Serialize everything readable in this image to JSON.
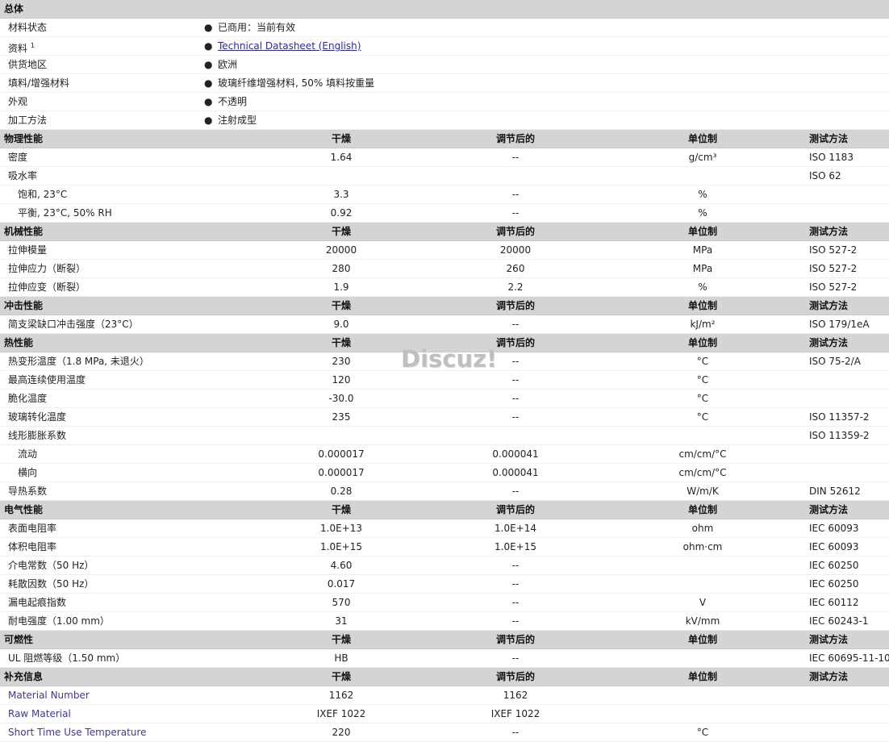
{
  "general": {
    "title": "总体",
    "rows": [
      {
        "label": "材料状态",
        "value": "已商用：当前有效"
      },
      {
        "label": "资料",
        "sup": "1",
        "value": "Technical Datasheet (English)",
        "link": true
      },
      {
        "label": "供货地区",
        "value": "欧洲"
      },
      {
        "label": "填料/增强材料",
        "value": "玻璃纤维增强材料, 50% 填料按重量"
      },
      {
        "label": "外观",
        "value": "不透明"
      },
      {
        "label": "加工方法",
        "value": "注射成型"
      }
    ]
  },
  "columns": {
    "dry": "干燥",
    "cond": "调节后的",
    "unit": "单位制",
    "method": "测试方法"
  },
  "sections": [
    {
      "title": "物理性能",
      "rows": [
        {
          "name": "密度",
          "dry": "1.64",
          "cond": "--",
          "unit": "g/cm³",
          "method": "ISO 1183"
        },
        {
          "name": "吸水率",
          "dry": "",
          "cond": "",
          "unit": "",
          "method": "ISO 62"
        },
        {
          "name": "饱和, 23°C",
          "sub": true,
          "dry": "3.3",
          "cond": "--",
          "unit": "%",
          "method": ""
        },
        {
          "name": "平衡, 23°C, 50% RH",
          "sub": true,
          "dry": "0.92",
          "cond": "--",
          "unit": "%",
          "method": ""
        }
      ]
    },
    {
      "title": "机械性能",
      "rows": [
        {
          "name": "拉伸模量",
          "dry": "20000",
          "cond": "20000",
          "unit": "MPa",
          "method": "ISO 527-2"
        },
        {
          "name": "拉伸应力（断裂）",
          "dry": "280",
          "cond": "260",
          "unit": "MPa",
          "method": "ISO 527-2"
        },
        {
          "name": "拉伸应变（断裂）",
          "dry": "1.9",
          "cond": "2.2",
          "unit": "%",
          "method": "ISO 527-2"
        }
      ]
    },
    {
      "title": "冲击性能",
      "rows": [
        {
          "name": "简支梁缺口冲击强度（23°C）",
          "dry": "9.0",
          "cond": "--",
          "unit": "kJ/m²",
          "method": "ISO 179/1eA"
        }
      ]
    },
    {
      "title": "热性能",
      "rows": [
        {
          "name": "热变形温度（1.8 MPa, 未退火）",
          "dry": "230",
          "cond": "--",
          "unit": "°C",
          "method": "ISO 75-2/A"
        },
        {
          "name": "最高连续使用温度",
          "dry": "120",
          "cond": "--",
          "unit": "°C",
          "method": ""
        },
        {
          "name": "脆化温度",
          "dry": "-30.0",
          "cond": "--",
          "unit": "°C",
          "method": ""
        },
        {
          "name": "玻璃转化温度",
          "dry": "235",
          "cond": "--",
          "unit": "°C",
          "method": "ISO 11357-2"
        },
        {
          "name": "线形膨胀系数",
          "dry": "",
          "cond": "",
          "unit": "",
          "method": "ISO 11359-2"
        },
        {
          "name": "流动",
          "sub": true,
          "dry": "0.000017",
          "cond": "0.000041",
          "unit": "cm/cm/°C",
          "method": ""
        },
        {
          "name": "横向",
          "sub": true,
          "dry": "0.000017",
          "cond": "0.000041",
          "unit": "cm/cm/°C",
          "method": ""
        },
        {
          "name": "导热系数",
          "dry": "0.28",
          "cond": "--",
          "unit": "W/m/K",
          "method": "DIN 52612"
        }
      ]
    },
    {
      "title": "电气性能",
      "rows": [
        {
          "name": "表面电阻率",
          "dry": "1.0E+13",
          "cond": "1.0E+14",
          "unit": "ohm",
          "method": "IEC 60093"
        },
        {
          "name": "体积电阻率",
          "dry": "1.0E+15",
          "cond": "1.0E+15",
          "unit": "ohm·cm",
          "method": "IEC 60093"
        },
        {
          "name": "介电常数（50 Hz）",
          "dry": "4.60",
          "cond": "--",
          "unit": "",
          "method": "IEC 60250"
        },
        {
          "name": "耗散因数（50 Hz）",
          "dry": "0.017",
          "cond": "--",
          "unit": "",
          "method": "IEC 60250"
        },
        {
          "name": "漏电起痕指数",
          "dry": "570",
          "cond": "--",
          "unit": "V",
          "method": "IEC 60112"
        },
        {
          "name": "耐电强度（1.00 mm）",
          "dry": "31",
          "cond": "--",
          "unit": "kV/mm",
          "method": "IEC 60243-1"
        }
      ]
    },
    {
      "title": "可燃性",
      "rows": [
        {
          "name": "UL 阻燃等级（1.50 mm）",
          "dry": "HB",
          "cond": "--",
          "unit": "",
          "method": "IEC 60695-11-10"
        }
      ]
    },
    {
      "title": "补充信息",
      "rows": [
        {
          "name": "Material Number",
          "eng": true,
          "dry": "1162",
          "cond": "1162",
          "unit": "",
          "method": ""
        },
        {
          "name": "Raw Material",
          "eng": true,
          "dry": "IXEF 1022",
          "cond": "IXEF 1022",
          "unit": "",
          "method": ""
        },
        {
          "name": "Short Time Use Temperature",
          "eng": true,
          "dry": "220",
          "cond": "--",
          "unit": "°C",
          "method": ""
        }
      ]
    }
  ],
  "watermark": "Discuz!"
}
